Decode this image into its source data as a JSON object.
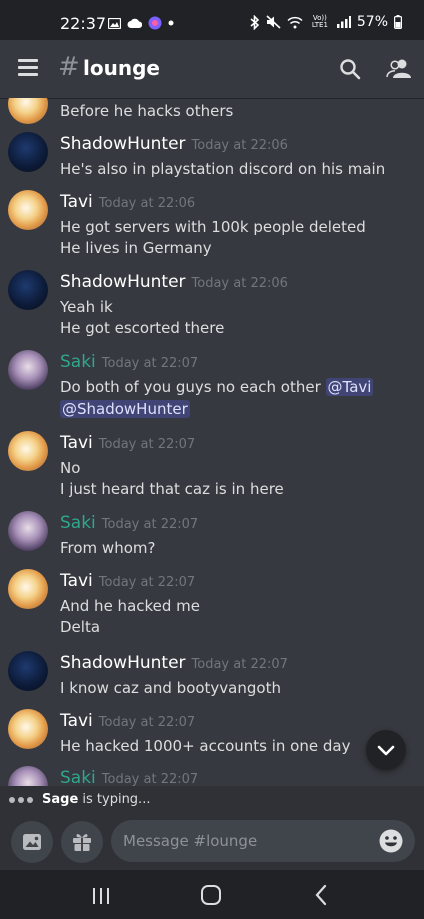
{
  "status_bar": {
    "time": "22:37",
    "battery": "57%",
    "network_label": "Vo)) LTE1"
  },
  "header": {
    "hash_symbol": "#",
    "channel_name": "lounge"
  },
  "messages": [
    {
      "author": "",
      "timestamp": "",
      "lines": [
        "Before he hacks others"
      ],
      "avatar": "tavi"
    },
    {
      "author": "ShadowHunter",
      "timestamp": "Today at 22:06",
      "lines": [
        "He's also in playstation discord on his main"
      ],
      "avatar": "shadow"
    },
    {
      "author": "Tavi",
      "timestamp": "Today at 22:06",
      "lines": [
        "He got servers with 100k people deleted",
        "He lives in Germany"
      ],
      "avatar": "tavi"
    },
    {
      "author": "ShadowHunter",
      "timestamp": "Today at 22:06",
      "lines": [
        "Yeah ik",
        "He got escorted there"
      ],
      "avatar": "shadow"
    },
    {
      "author": "Saki",
      "timestamp": "Today at 22:07",
      "line1_text": "Do both of you guys no each other ",
      "mention1": "@Tavi",
      "mention2": "@ShadowHunter",
      "avatar": "saki"
    },
    {
      "author": "Tavi",
      "timestamp": "Today at 22:07",
      "lines": [
        "No",
        "I just heard that caz is in here"
      ],
      "avatar": "tavi"
    },
    {
      "author": "Saki",
      "timestamp": "Today at 22:07",
      "lines": [
        "From whom?"
      ],
      "avatar": "saki"
    },
    {
      "author": "Tavi",
      "timestamp": "Today at 22:07",
      "lines": [
        "And he hacked me",
        "Delta"
      ],
      "avatar": "tavi"
    },
    {
      "author": "ShadowHunter",
      "timestamp": "Today at 22:07",
      "lines": [
        "I know caz and bootyvangoth"
      ],
      "avatar": "shadow"
    },
    {
      "author": "Tavi",
      "timestamp": "Today at 22:07",
      "lines": [
        "He hacked 1000+ accounts in one day"
      ],
      "avatar": "tavi"
    },
    {
      "author": "Saki",
      "timestamp": "Today at 22:07",
      "lines": [],
      "avatar": "saki"
    }
  ],
  "typing": {
    "user": "Sage",
    "suffix": " is typing..."
  },
  "composer": {
    "placeholder": "Message #lounge"
  },
  "colors": {
    "background": "#36393f",
    "saki_name": "#2fa78b",
    "mention_bg": "#4a4f8c",
    "timestamp": "#72767d"
  },
  "icons": [
    "menu-icon",
    "search-icon",
    "members-icon",
    "image-icon",
    "gift-icon",
    "emoji-icon",
    "chevron-down-icon",
    "nav-recents-icon",
    "nav-home-icon",
    "nav-back-icon"
  ]
}
